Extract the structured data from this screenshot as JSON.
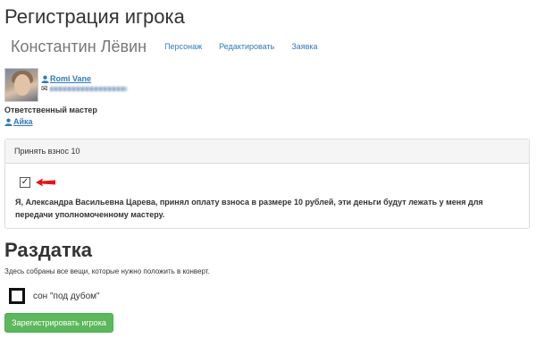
{
  "page": {
    "title": "Регистрация игрока"
  },
  "header": {
    "player_name": "Константин Лёвин",
    "nav": [
      {
        "label": "Персонаж"
      },
      {
        "label": "Редактировать"
      },
      {
        "label": "Заявка"
      }
    ]
  },
  "player": {
    "user_name": "Romi Vane",
    "avatar_icon": "user-photo",
    "mail_icon": "envelope-icon",
    "user_icon": "user-icon"
  },
  "master": {
    "label": "Ответственный мастер",
    "name": "Айка"
  },
  "fee_panel": {
    "heading": "Принять взнос 10",
    "checked": true,
    "consent_text": "Я, Александра Васильевна Царева, принял оплату взноса в размере 10 рублей, эти деньги будут лежать у меня для передачи уполномоченному мастеру."
  },
  "distribution": {
    "title": "Раздатка",
    "description": "Здесь собраны все вещи, которые нужно положить в конверт.",
    "items": [
      {
        "label": "сон \"под дубом\"",
        "checked": false
      }
    ]
  },
  "actions": {
    "submit_label": "Зарегистрировать игрока"
  },
  "colors": {
    "link": "#337ab7",
    "success": "#5cb85c",
    "arrow": "#e8121a",
    "muted": "#777777"
  }
}
